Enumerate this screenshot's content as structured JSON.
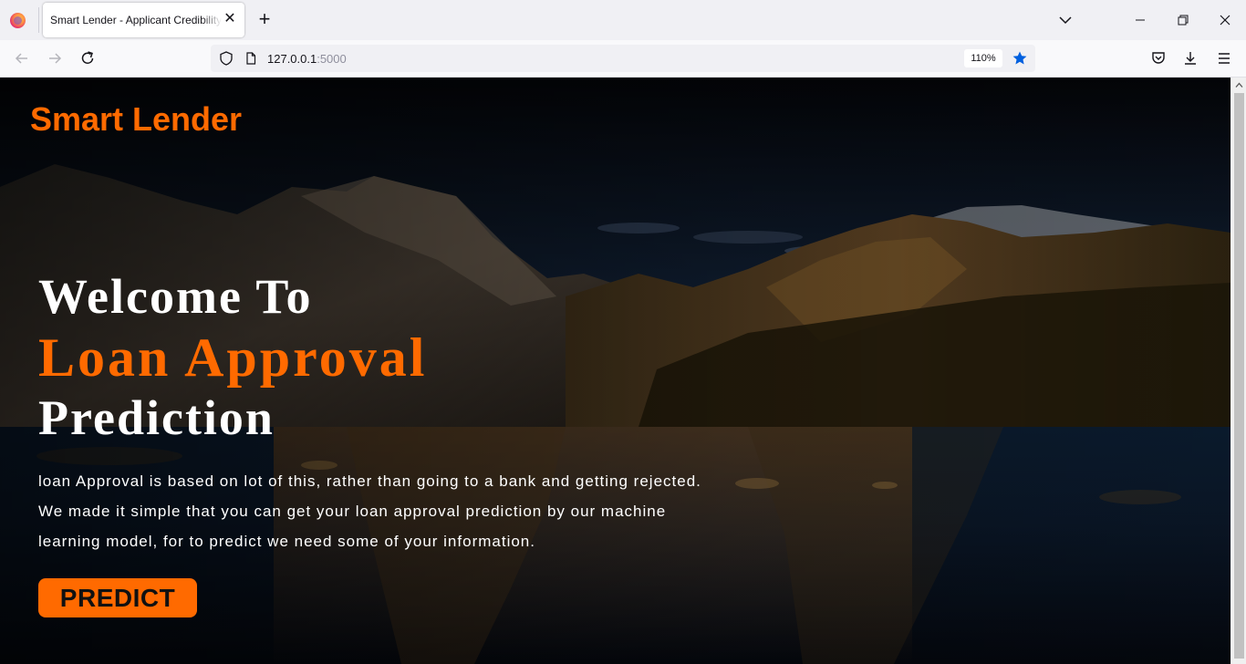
{
  "browser": {
    "tab": {
      "title": "Smart Lender - Applicant Credibility Prediction",
      "close_glyph": "✕"
    },
    "new_tab_glyph": "+",
    "url": {
      "host": "127.0.0.1",
      "port": ":5000"
    },
    "zoom": "110%",
    "icons": {
      "firefox": "firefox-logo-icon",
      "back": "back-arrow-icon",
      "forward": "forward-arrow-icon",
      "reload": "reload-icon",
      "shield": "tracking-shield-icon",
      "page": "page-icon",
      "bookmark": "star-icon",
      "pocket": "pocket-icon",
      "downloads": "download-icon",
      "menu": "hamburger-menu-icon"
    },
    "accent": "#0060df"
  },
  "page": {
    "brand": "Smart Lender",
    "hero": {
      "line1": "Welcome To",
      "line2": "Loan Approval",
      "line3": "Prediction"
    },
    "description": {
      "line1": "loan Approval is based on lot of this, rather than going to a bank and getting rejected.",
      "line2": "We made it simple that you can get your loan approval prediction by our machine",
      "line3": "learning model, for to predict we need some of your information."
    },
    "cta": "PREDICT",
    "colors": {
      "accent": "#ff6a00",
      "text": "#ffffff"
    }
  }
}
